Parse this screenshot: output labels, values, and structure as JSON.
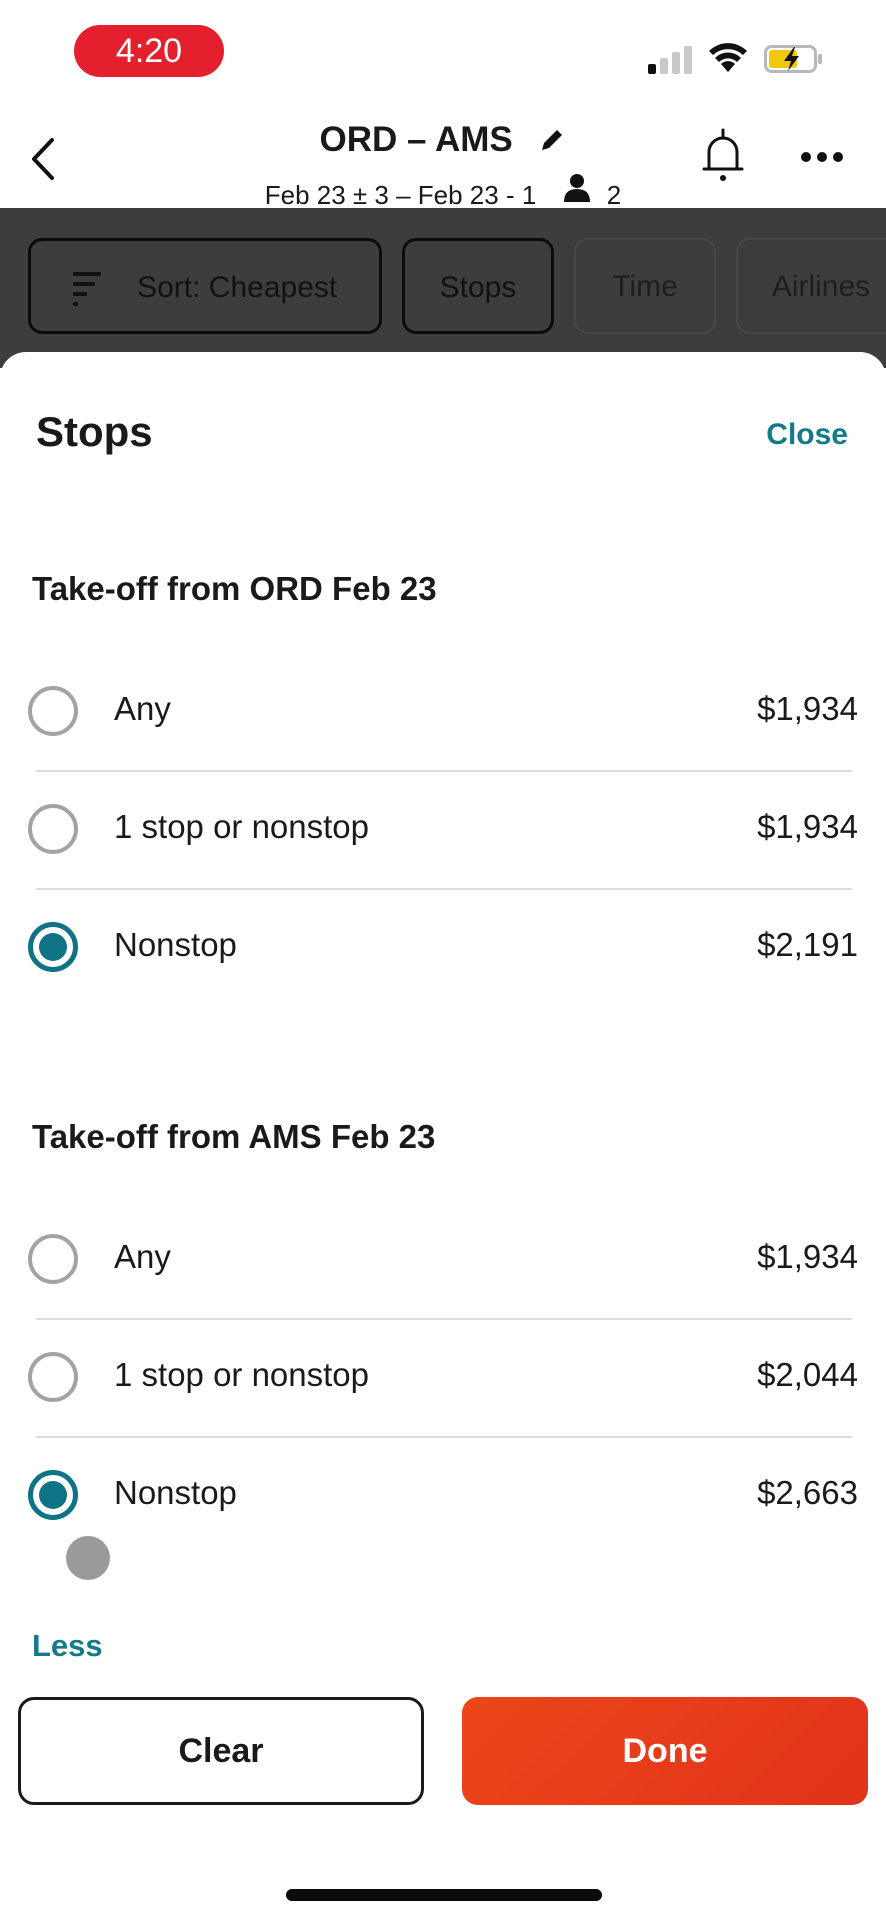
{
  "status_bar": {
    "time": "4:20",
    "signal_bars_on": 1,
    "signal_bars_total": 4,
    "battery_state": "charging"
  },
  "header": {
    "title": "ORD – AMS",
    "subtitle_dates": "Feb 23 ± 3 – Feb 23 - 1",
    "passengers": "2",
    "icons": [
      "back-icon",
      "edit-icon",
      "person-icon",
      "bell-icon",
      "more-icon"
    ]
  },
  "filter_bar": {
    "chips": [
      {
        "label": "Sort: Cheapest",
        "icon": "sort-icon",
        "selected": true
      },
      {
        "label": "Stops",
        "selected": true
      },
      {
        "label": "Time",
        "selected": false
      },
      {
        "label": "Airlines",
        "selected": false
      }
    ]
  },
  "sheet": {
    "title": "Stops",
    "close_label": "Close",
    "sections": [
      {
        "title": "Take-off from ORD Feb 23",
        "options": [
          {
            "label": "Any",
            "price": "$1,934",
            "selected": false
          },
          {
            "label": "1 stop or nonstop",
            "price": "$1,934",
            "selected": false
          },
          {
            "label": "Nonstop",
            "price": "$2,191",
            "selected": true
          }
        ]
      },
      {
        "title": "Take-off from AMS Feb 23",
        "options": [
          {
            "label": "Any",
            "price": "$1,934",
            "selected": false
          },
          {
            "label": "1 stop or nonstop",
            "price": "$2,044",
            "selected": false
          },
          {
            "label": "Nonstop",
            "price": "$2,663",
            "selected": true
          }
        ]
      }
    ],
    "less_label": "Less",
    "clear_label": "Clear",
    "done_label": "Done"
  },
  "colors": {
    "accent_teal": "#0f7285",
    "link_teal": "#137a8a",
    "done_orange": "#e63a1a",
    "time_pill_red": "#e5202e",
    "dim_overlay": "#3d3d40"
  }
}
